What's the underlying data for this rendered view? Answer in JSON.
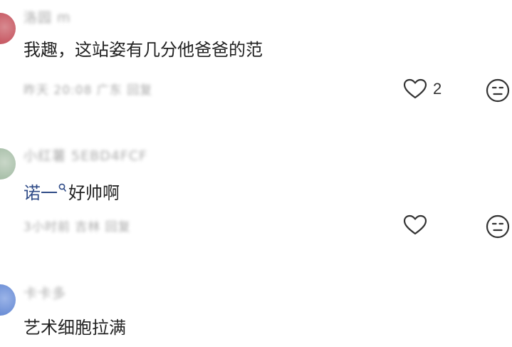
{
  "comments": [
    {
      "username": "洛园 m",
      "content": "我趣，这站姿有几分他爸爸的范",
      "meta": "昨天 20:08 广东 回复",
      "likes": "2"
    },
    {
      "username": "小红薯 5EBD4FCF",
      "mention": "诺一",
      "content": "好帅啊",
      "meta": "3小时前 吉林 回复",
      "likes": ""
    },
    {
      "username": "卡卡多",
      "content": "艺术细胞拉满"
    }
  ],
  "icons": {
    "like": "heart-outline-icon",
    "dislike": "neutral-face-icon",
    "mention": "search-icon"
  }
}
